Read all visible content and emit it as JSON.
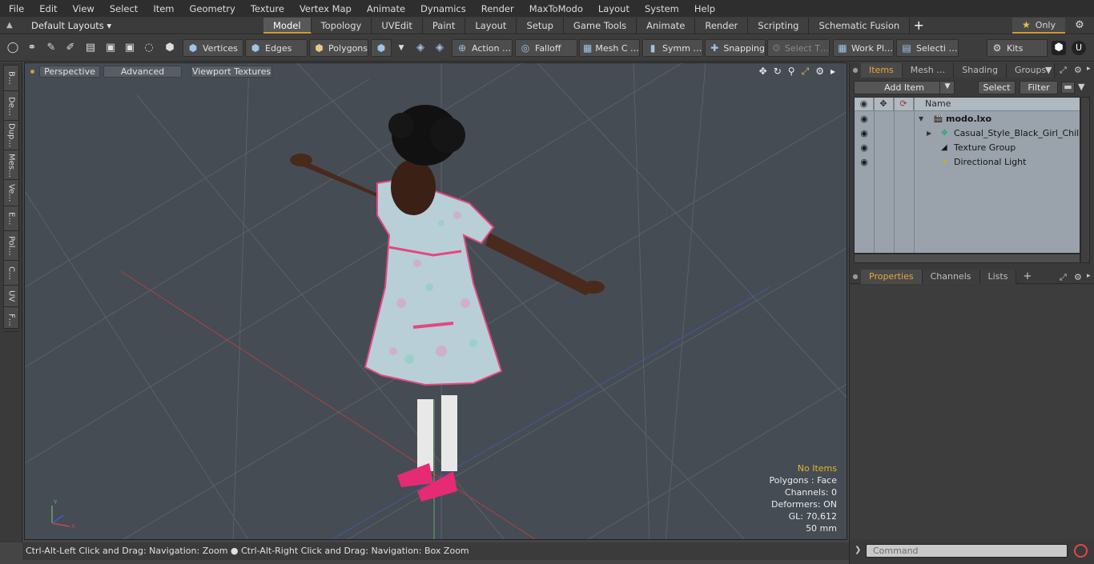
{
  "menu": [
    "File",
    "Edit",
    "View",
    "Select",
    "Item",
    "Geometry",
    "Texture",
    "Vertex Map",
    "Animate",
    "Dynamics",
    "Render",
    "MaxToModo",
    "Layout",
    "System",
    "Help"
  ],
  "layoutbar": {
    "layouts_label": "Default Layouts ▾",
    "tabs": [
      "Model",
      "Topology",
      "UVEdit",
      "Paint",
      "Layout",
      "Setup",
      "Game Tools",
      "Animate",
      "Render",
      "Scripting",
      "Schematic Fusion"
    ],
    "active_tab": "Model",
    "only_label": "Only"
  },
  "toolbar": {
    "vertices": "Vertices",
    "edges": "Edges",
    "polygons": "Polygons",
    "action": "Action …",
    "falloff": "Falloff",
    "mesh": "Mesh C …",
    "symmetry": "Symm …",
    "snapping": "Snapping",
    "select_t": "Select T…",
    "workplane": "Work Pl…",
    "selection": "Selecti …",
    "kits": "Kits"
  },
  "left_tabs": [
    "B…",
    "De…",
    "Dup…",
    "Mes…",
    "Ve…",
    "E…",
    "Pol…",
    "C…",
    "UV",
    "F…"
  ],
  "viewport": {
    "perspective": "Perspective",
    "advanced": "Advanced",
    "textures": "Viewport Textures",
    "info": {
      "no_items": "No Items",
      "polygons": "Polygons : Face",
      "channels": "Channels: 0",
      "deformers": "Deformers: ON",
      "gl": "GL: 70,612",
      "scale": "50 mm"
    }
  },
  "status": "Ctrl-Alt-Left Click and Drag: Navigation: Zoom ● Ctrl-Alt-Right Click and Drag: Navigation: Box Zoom",
  "items_panel": {
    "tabs": [
      "Items",
      "Mesh …",
      "Shading",
      "Groups"
    ],
    "active_tab": "Items",
    "add_item": "Add Item",
    "select": "Select",
    "filter": "Filter",
    "name_header": "Name",
    "rows": [
      {
        "label": "modo.lxo"
      },
      {
        "label": "Casual_Style_Black_Girl_Child…"
      },
      {
        "label": "Texture Group"
      },
      {
        "label": "Directional Light"
      }
    ]
  },
  "props_panel": {
    "tabs": [
      "Properties",
      "Channels",
      "Lists"
    ],
    "active_tab": "Properties"
  },
  "command": {
    "placeholder": "Command"
  },
  "colors": {
    "accent": "#d29a3a",
    "viewport_bg": "#454c54",
    "warn": "#e8b32a"
  }
}
